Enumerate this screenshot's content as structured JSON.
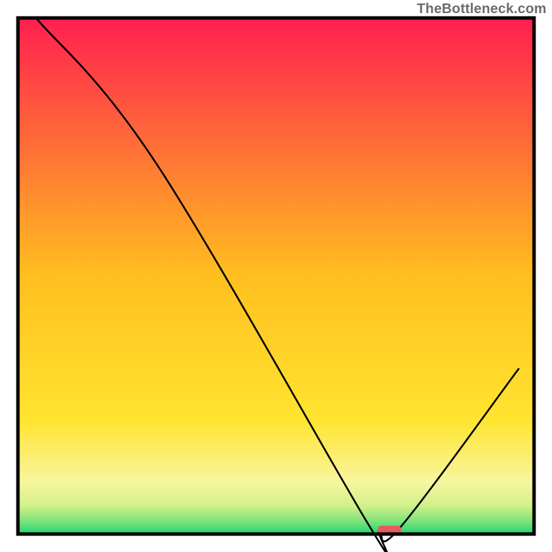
{
  "watermark": "TheBottleneck.com",
  "chart_data": {
    "type": "line",
    "title": "",
    "xlabel": "",
    "ylabel": "",
    "xlim": [
      0,
      100
    ],
    "ylim": [
      0,
      100
    ],
    "x": [
      3.5,
      27.0,
      68.0,
      70.0,
      74.0,
      97.0
    ],
    "y": [
      100.0,
      71.5,
      1.7,
      0.8,
      1.2,
      32.0
    ],
    "annotations": [
      {
        "kind": "marker",
        "x": 72.0,
        "y": 0.8,
        "color": "#e35a63",
        "shape": "rounded-rect"
      }
    ],
    "background_gradient": {
      "stops": [
        {
          "offset": 0.0,
          "color": "#ff1f4f"
        },
        {
          "offset": 0.5,
          "color": "#ffbf1f"
        },
        {
          "offset": 0.78,
          "color": "#ffe430"
        },
        {
          "offset": 0.9,
          "color": "#f8f6a0"
        },
        {
          "offset": 0.945,
          "color": "#d2f08a"
        },
        {
          "offset": 0.975,
          "color": "#7fe37a"
        },
        {
          "offset": 1.0,
          "color": "#1fd474"
        }
      ]
    },
    "frame_color": "#000000",
    "line_color": "#000000",
    "line_width": 2.6
  }
}
